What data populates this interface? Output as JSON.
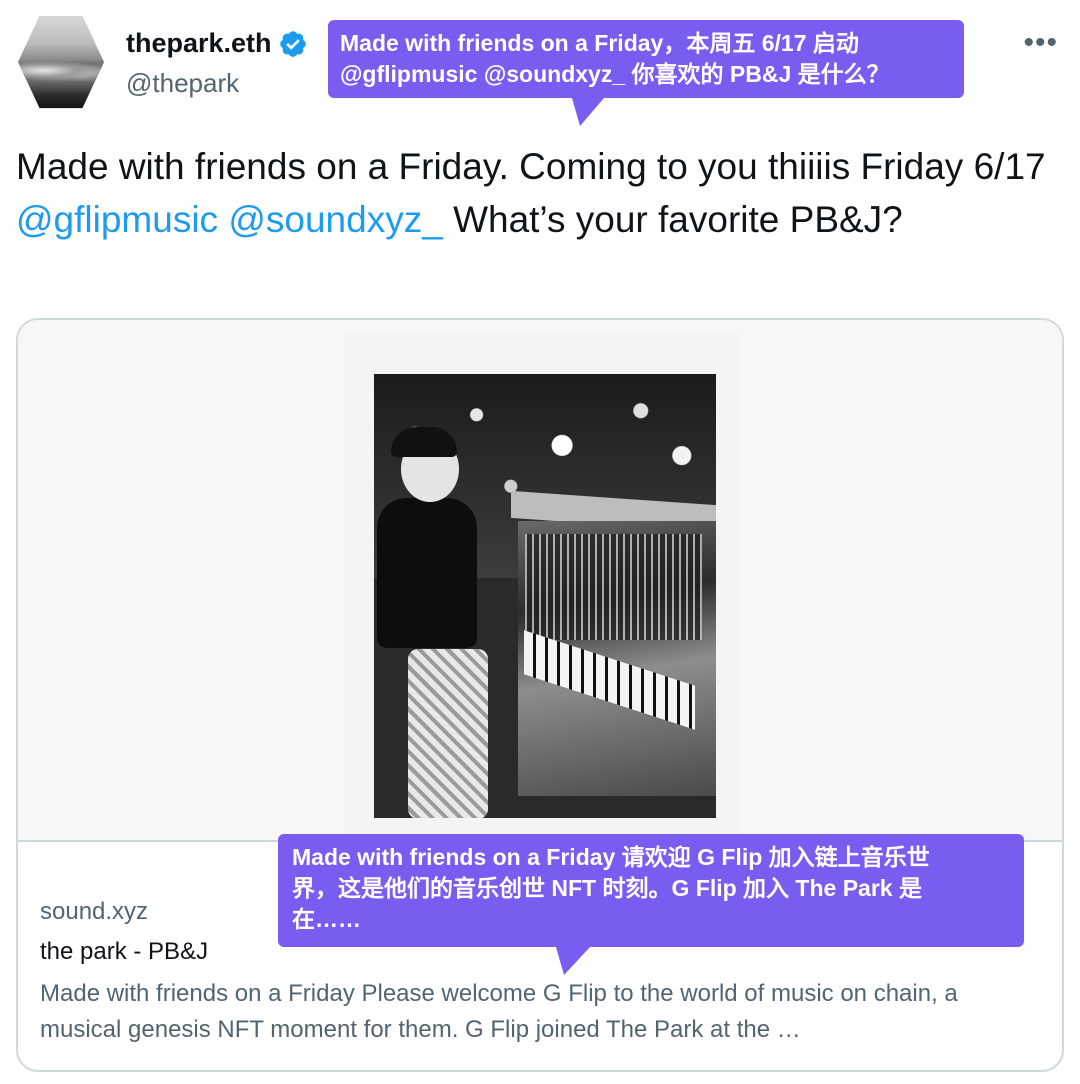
{
  "author": {
    "display_name": "thepark.eth",
    "handle": "@thepark",
    "verified_icon": "verified-badge-icon",
    "more_label": "•••"
  },
  "tweet": {
    "text_part1": "Made with friends on a Friday. Coming to you thiiiis Friday 6/17 ",
    "mention_1": "@gflipmusic",
    "mention_2": "@soundxyz_",
    "text_part2": " What’s your favorite PB&J?"
  },
  "card": {
    "domain": "sound.xyz",
    "title": "the park - PB&J",
    "description": "Made with friends on a Friday Please welcome G Flip to the world of music on chain, a musical genesis NFT moment for them. G Flip joined The Park at the …"
  },
  "translations": {
    "tweet_line1": "Made with friends on a Friday，本周五 6/17 启动",
    "tweet_line2": "@gflipmusic @soundxyz_ 你喜欢的 PB&J 是什么？",
    "card_line1": "Made with friends on a Friday 请欢迎 G Flip 加入链上音乐世",
    "card_line2": "界，这是他们的音乐创世 NFT 时刻。G Flip 加入 The Park 是",
    "card_line3": "在……"
  },
  "colors": {
    "mention": "#1d9bf0",
    "bubble": "#7a5cf0",
    "secondary_text": "#536471",
    "border": "#cfd9de"
  }
}
